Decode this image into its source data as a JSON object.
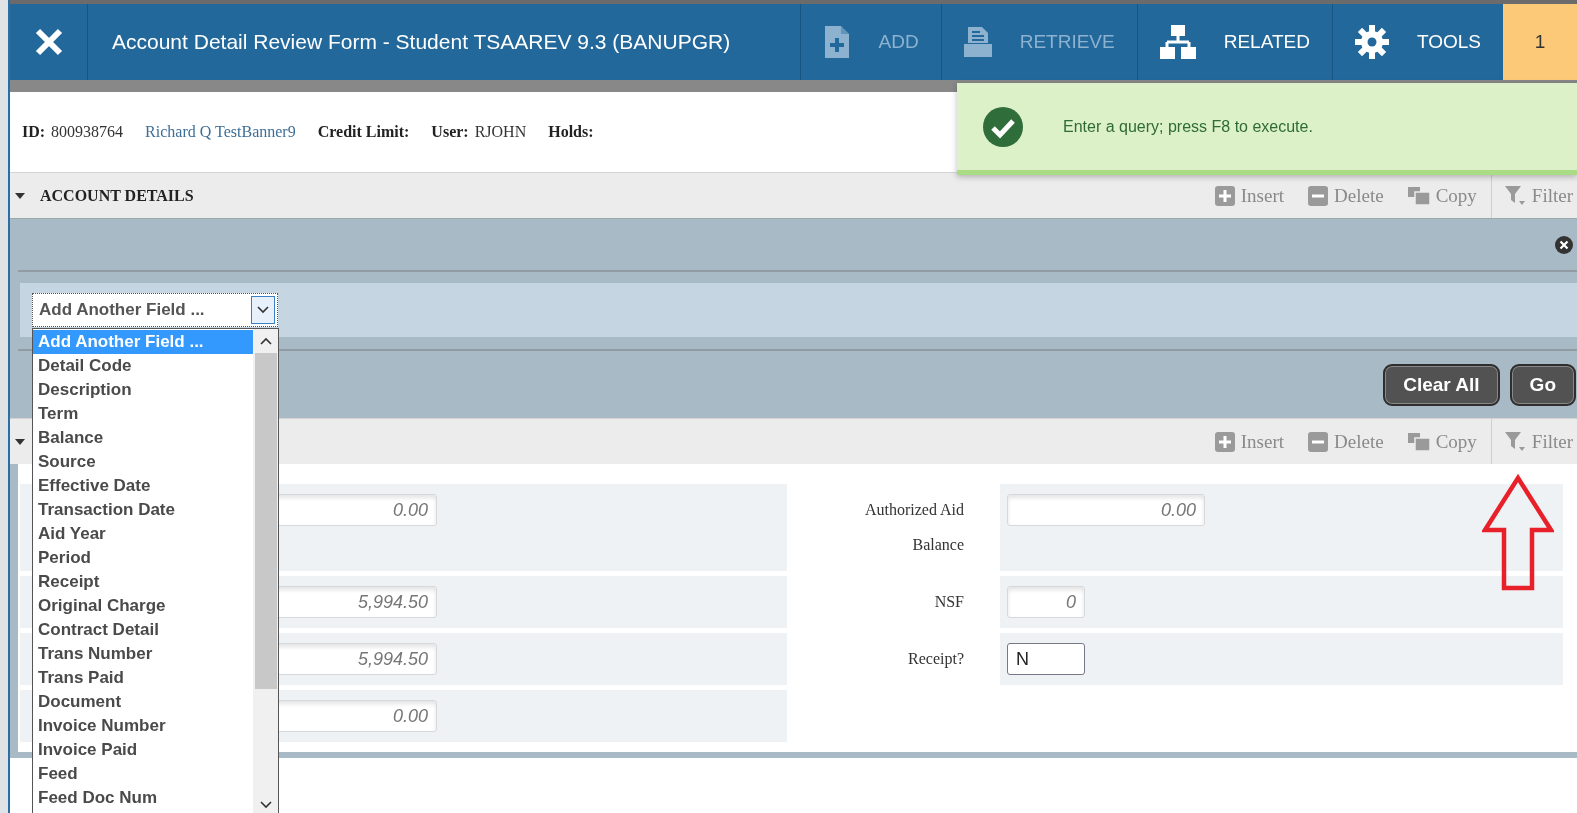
{
  "header": {
    "title": "Account Detail Review Form - Student TSAAREV 9.3 (BANUPGR)",
    "actions": [
      {
        "label": "ADD",
        "kind": "add",
        "disabled": true
      },
      {
        "label": "RETRIEVE",
        "kind": "retrieve",
        "disabled": true
      },
      {
        "label": "RELATED",
        "kind": "related",
        "disabled": false
      },
      {
        "label": "TOOLS",
        "kind": "tools",
        "disabled": false
      }
    ],
    "badge": "1"
  },
  "info": [
    {
      "label": "ID:",
      "value": "800938764",
      "kind": "text"
    },
    {
      "value": "Richard Q TestBanner9",
      "kind": "link"
    },
    {
      "label": "Credit Limit:",
      "kind": "text"
    },
    {
      "label": "User:",
      "value": "RJOHN",
      "kind": "text"
    },
    {
      "label": "Holds:",
      "kind": "text"
    }
  ],
  "notification": {
    "message": "Enter a query; press F8 to execute."
  },
  "sections": [
    {
      "title": "ACCOUNT DETAILS",
      "expanded": true,
      "tools": [
        {
          "label": "Insert",
          "kind": "insert"
        },
        {
          "label": "Delete",
          "kind": "delete"
        },
        {
          "label": "Copy",
          "kind": "copy"
        },
        {
          "label": "Filter",
          "kind": "filter"
        }
      ]
    },
    {
      "expanded": true,
      "tools": [
        {
          "label": "Insert",
          "kind": "insert"
        },
        {
          "label": "Delete",
          "kind": "delete"
        },
        {
          "label": "Copy",
          "kind": "copy"
        },
        {
          "label": "Filter",
          "kind": "filter"
        }
      ]
    }
  ],
  "filter_panel": {
    "select": {
      "value": "Add Another Field ...",
      "expanded": true,
      "options": [
        {
          "label": "Add Another Field ...",
          "selected": true
        },
        {
          "label": "Detail Code",
          "selected": false
        },
        {
          "label": "Description",
          "selected": false
        },
        {
          "label": "Term",
          "selected": false
        },
        {
          "label": "Balance",
          "selected": false
        },
        {
          "label": "Source",
          "selected": false
        },
        {
          "label": "Effective Date",
          "selected": false
        },
        {
          "label": "Transaction Date",
          "selected": false
        },
        {
          "label": "Aid Year",
          "selected": false
        },
        {
          "label": "Period",
          "selected": false
        },
        {
          "label": "Receipt",
          "selected": false
        },
        {
          "label": "Original Charge",
          "selected": false
        },
        {
          "label": "Contract Detail",
          "selected": false
        },
        {
          "label": "Trans Number",
          "selected": false
        },
        {
          "label": "Trans Paid",
          "selected": false
        },
        {
          "label": "Document",
          "selected": false
        },
        {
          "label": "Invoice Number",
          "selected": false
        },
        {
          "label": "Invoice Paid",
          "selected": false
        },
        {
          "label": "Feed",
          "selected": false
        },
        {
          "label": "Feed Doc Num",
          "selected": false
        }
      ]
    },
    "buttons": [
      "Clear All",
      "Go"
    ]
  },
  "form": {
    "left_fields": [
      {
        "value": "0.00"
      },
      {
        "value": "5,994.50"
      },
      {
        "value": "5,994.50"
      },
      {
        "value": "0.00"
      }
    ],
    "right_fields": [
      {
        "label": "Authorized Aid Balance",
        "value": "0.00",
        "kind": "number"
      },
      {
        "label": "NSF",
        "value": "0",
        "kind": "number"
      },
      {
        "label": "Receipt?",
        "value": "N",
        "kind": "text"
      }
    ]
  }
}
